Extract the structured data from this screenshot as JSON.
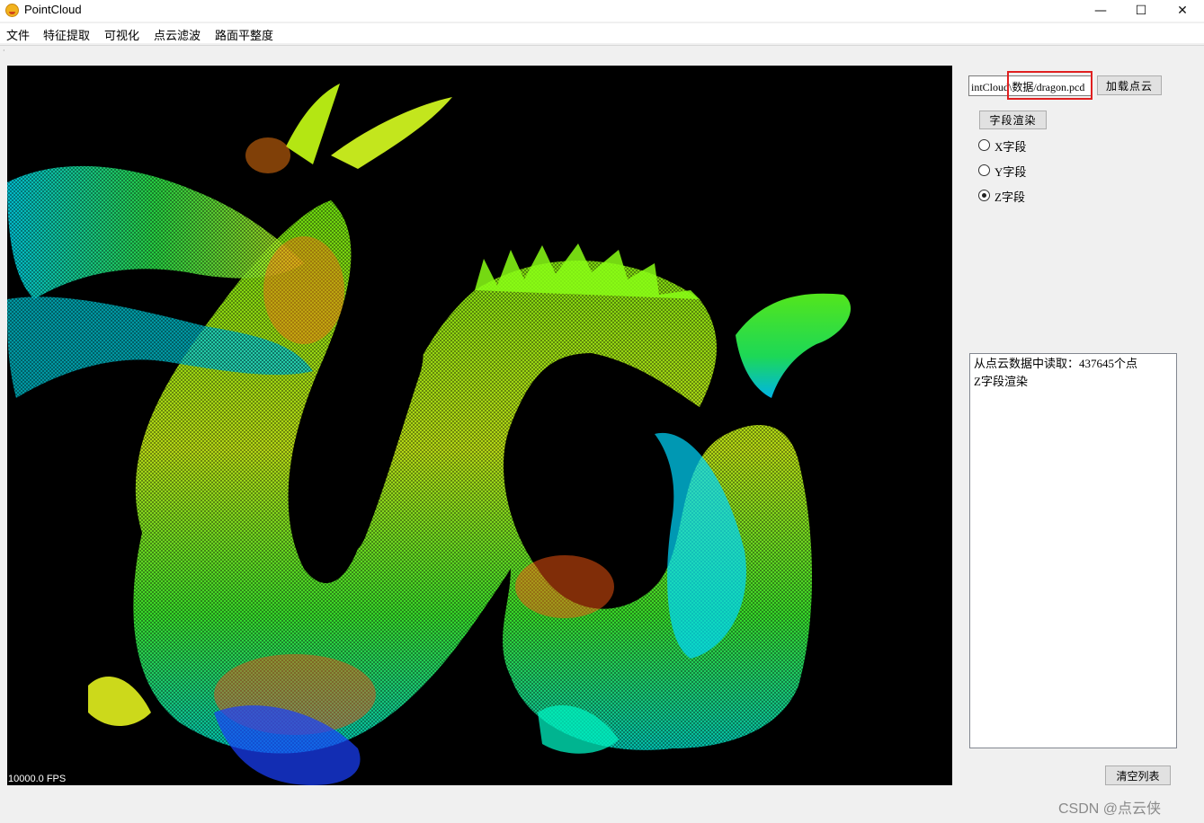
{
  "window": {
    "title": "PointCloud",
    "controls": {
      "minimize": "—",
      "maximize": "☐",
      "close": "✕"
    }
  },
  "menu": [
    "文件",
    "特征提取",
    "可视化",
    "点云滤波",
    "路面平整度"
  ],
  "viewer": {
    "fps_text": "10000.0 FPS",
    "colors": {
      "background": "#000000",
      "low": "#1a2cff",
      "mid": "#00e0ff",
      "green": "#20ff30",
      "yellow": "#e8ff20",
      "high": "#ff4010"
    }
  },
  "controls": {
    "file_path": "intCloud\\数据/dragon.pcd",
    "load_button": "加载点云",
    "render_button": "字段渲染",
    "radios": [
      {
        "label": "X字段",
        "checked": false
      },
      {
        "label": "Y字段",
        "checked": false
      },
      {
        "label": "Z字段",
        "checked": true
      }
    ],
    "clear_button": "清空列表"
  },
  "log": [
    "从点云数据中读取：437645个点",
    "Z字段渲染"
  ],
  "watermark": "CSDN @点云侠",
  "accent": {
    "highlight": "#e02020"
  }
}
